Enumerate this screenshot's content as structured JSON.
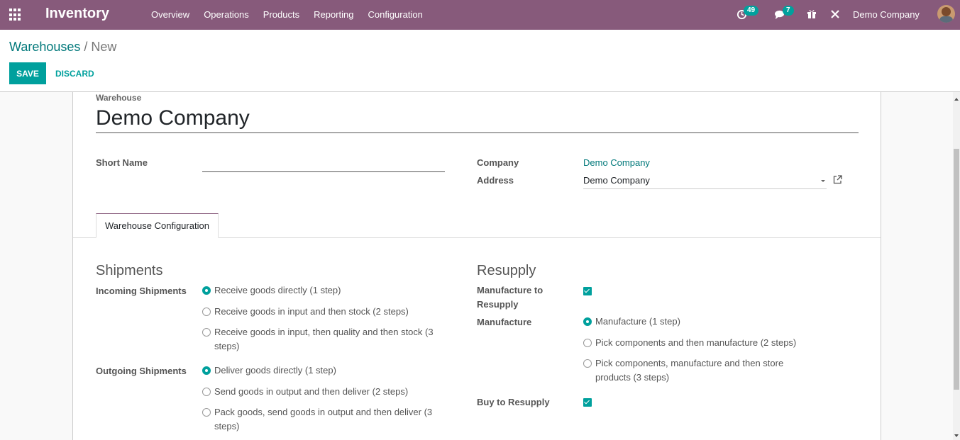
{
  "navbar": {
    "app_name": "Inventory",
    "menu": [
      "Overview",
      "Operations",
      "Products",
      "Reporting",
      "Configuration"
    ],
    "activity_badge": "49",
    "messages_badge": "7",
    "company": "Demo Company"
  },
  "breadcrumb": {
    "parent": "Warehouses",
    "separator": "/",
    "current": "New"
  },
  "actions": {
    "save_label": "SAVE",
    "discard_label": "DISCARD"
  },
  "form": {
    "name_label": "Warehouse",
    "name_value": "Demo Company",
    "short_name_label": "Short Name",
    "short_name_value": "",
    "company_label": "Company",
    "company_value": "Demo Company",
    "address_label": "Address",
    "address_value": "Demo Company"
  },
  "tab": {
    "label": "Warehouse Configuration"
  },
  "shipments": {
    "title": "Shipments",
    "incoming_label": "Incoming Shipments",
    "incoming_options": [
      {
        "line1": "Receive goods directly (1 step)",
        "line2": "",
        "checked": true
      },
      {
        "line1": "Receive goods in input and then stock (2 steps)",
        "line2": "",
        "checked": false
      },
      {
        "line1": "Receive goods in input, then quality and then stock (3",
        "line2": "steps)",
        "checked": false
      }
    ],
    "outgoing_label": "Outgoing Shipments",
    "outgoing_options": [
      {
        "line1": "Deliver goods directly (1 step)",
        "line2": "",
        "checked": true
      },
      {
        "line1": "Send goods in output and then deliver (2 steps)",
        "line2": "",
        "checked": false
      },
      {
        "line1": "Pack goods, send goods in output and then deliver (3",
        "line2": "steps)",
        "checked": false
      }
    ]
  },
  "resupply": {
    "title": "Resupply",
    "manufacture_to_resupply_label_1": "Manufacture to",
    "manufacture_to_resupply_label_2": "Resupply",
    "manufacture_to_resupply_checked": true,
    "manufacture_label": "Manufacture",
    "manufacture_options": [
      {
        "line1": "Manufacture (1 step)",
        "line2": "",
        "checked": true
      },
      {
        "line1": "Pick components and then manufacture (2 steps)",
        "line2": "",
        "checked": false
      },
      {
        "line1": "Pick components, manufacture and then store",
        "line2": "products (3 steps)",
        "checked": false
      }
    ],
    "buy_label": "Buy to Resupply",
    "buy_checked": true
  },
  "colors": {
    "navbar": "#875a7b",
    "accent": "#00a09d",
    "link": "#00787a"
  }
}
